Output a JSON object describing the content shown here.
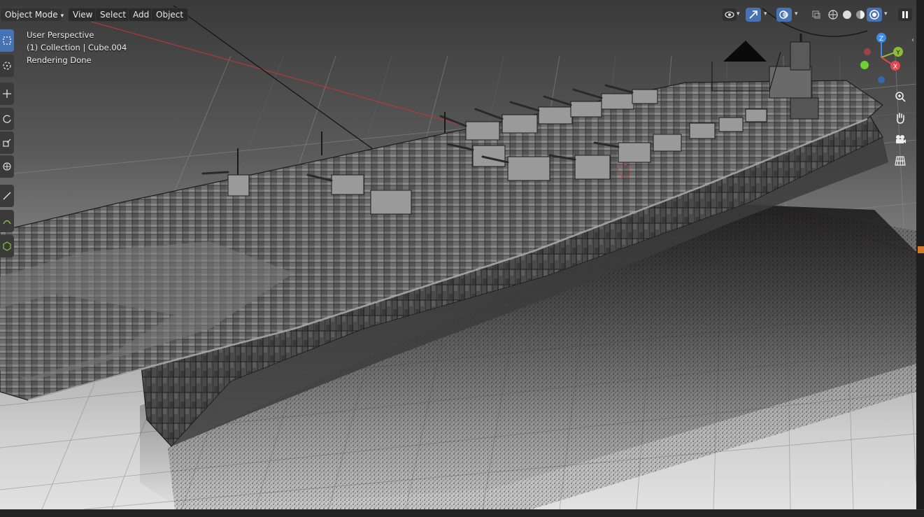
{
  "header": {
    "mode": "Object Mode",
    "menus": [
      "View",
      "Select",
      "Add",
      "Object"
    ]
  },
  "overlay": {
    "view_name": "User Perspective",
    "collection": "(1) Collection | Cube.004",
    "status": "Rendering Done"
  },
  "gizmo": {
    "z": "Z",
    "y": "Y",
    "x": "X"
  },
  "colors": {
    "accent": "#4772b3",
    "axis_x": "#e0474f",
    "axis_y": "#8cbc3a",
    "axis_z": "#3d8ce6",
    "x_axis_line": "#b03a3a"
  },
  "icons": {
    "toolbar": [
      "select-box-icon",
      "cursor-icon",
      "move-icon",
      "rotate-icon",
      "scale-icon",
      "transform-icon",
      "annotate-icon",
      "measure-icon",
      "add-cube-icon"
    ],
    "nav": [
      "zoom-icon",
      "hand-pan-icon",
      "camera-icon",
      "grid-ortho-icon"
    ],
    "header_right": [
      "visibility-icon",
      "gizmo-icon",
      "overlay-icon",
      "xray-icon",
      "wireframe-shading-icon",
      "solid-shading-icon",
      "material-shading-icon",
      "rendered-shading-icon"
    ]
  }
}
